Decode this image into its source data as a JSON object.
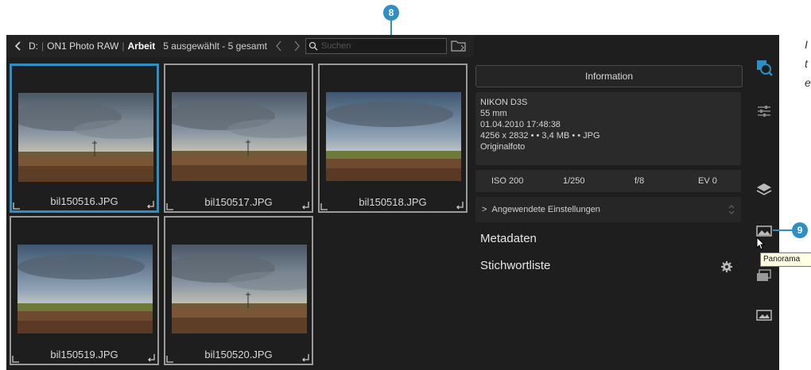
{
  "pathbar": {
    "drive": "D:",
    "folder": "ON1 Photo RAW",
    "subfolder": "Arbeit",
    "selection_count": "5 ausgewählt - 5 gesamt"
  },
  "search": {
    "placeholder": "Suchen"
  },
  "thumbnails": [
    {
      "name": "bil150516.JPG",
      "selected": true
    },
    {
      "name": "bil150517.JPG",
      "selected": false
    },
    {
      "name": "bil150518.JPG",
      "selected": false
    },
    {
      "name": "bil150519.JPG",
      "selected": false
    },
    {
      "name": "bil150520.JPG",
      "selected": false
    }
  ],
  "info_panel": {
    "tab_label": "Information",
    "camera": "NIKON D3S",
    "focal_length": "55 mm",
    "datetime": "01.04.2010 17:48:38",
    "file_details": "4256 x 2832 • • 3,4 MB • • JPG",
    "file_type": "Originalfoto",
    "exif": {
      "iso": "ISO 200",
      "shutter": "1/250",
      "aperture": "f/8",
      "ev": "EV 0"
    },
    "applied_settings": "Angewendete Einstellungen",
    "metadata": "Metadaten",
    "keyword_list": "Stichwortliste"
  },
  "tooltip": "Panorama",
  "callouts": [
    "8",
    "9"
  ],
  "side_text": [
    "I",
    "t",
    "e"
  ],
  "colors": {
    "accent": "#2f8fc4",
    "background": "#1e1e1e"
  }
}
